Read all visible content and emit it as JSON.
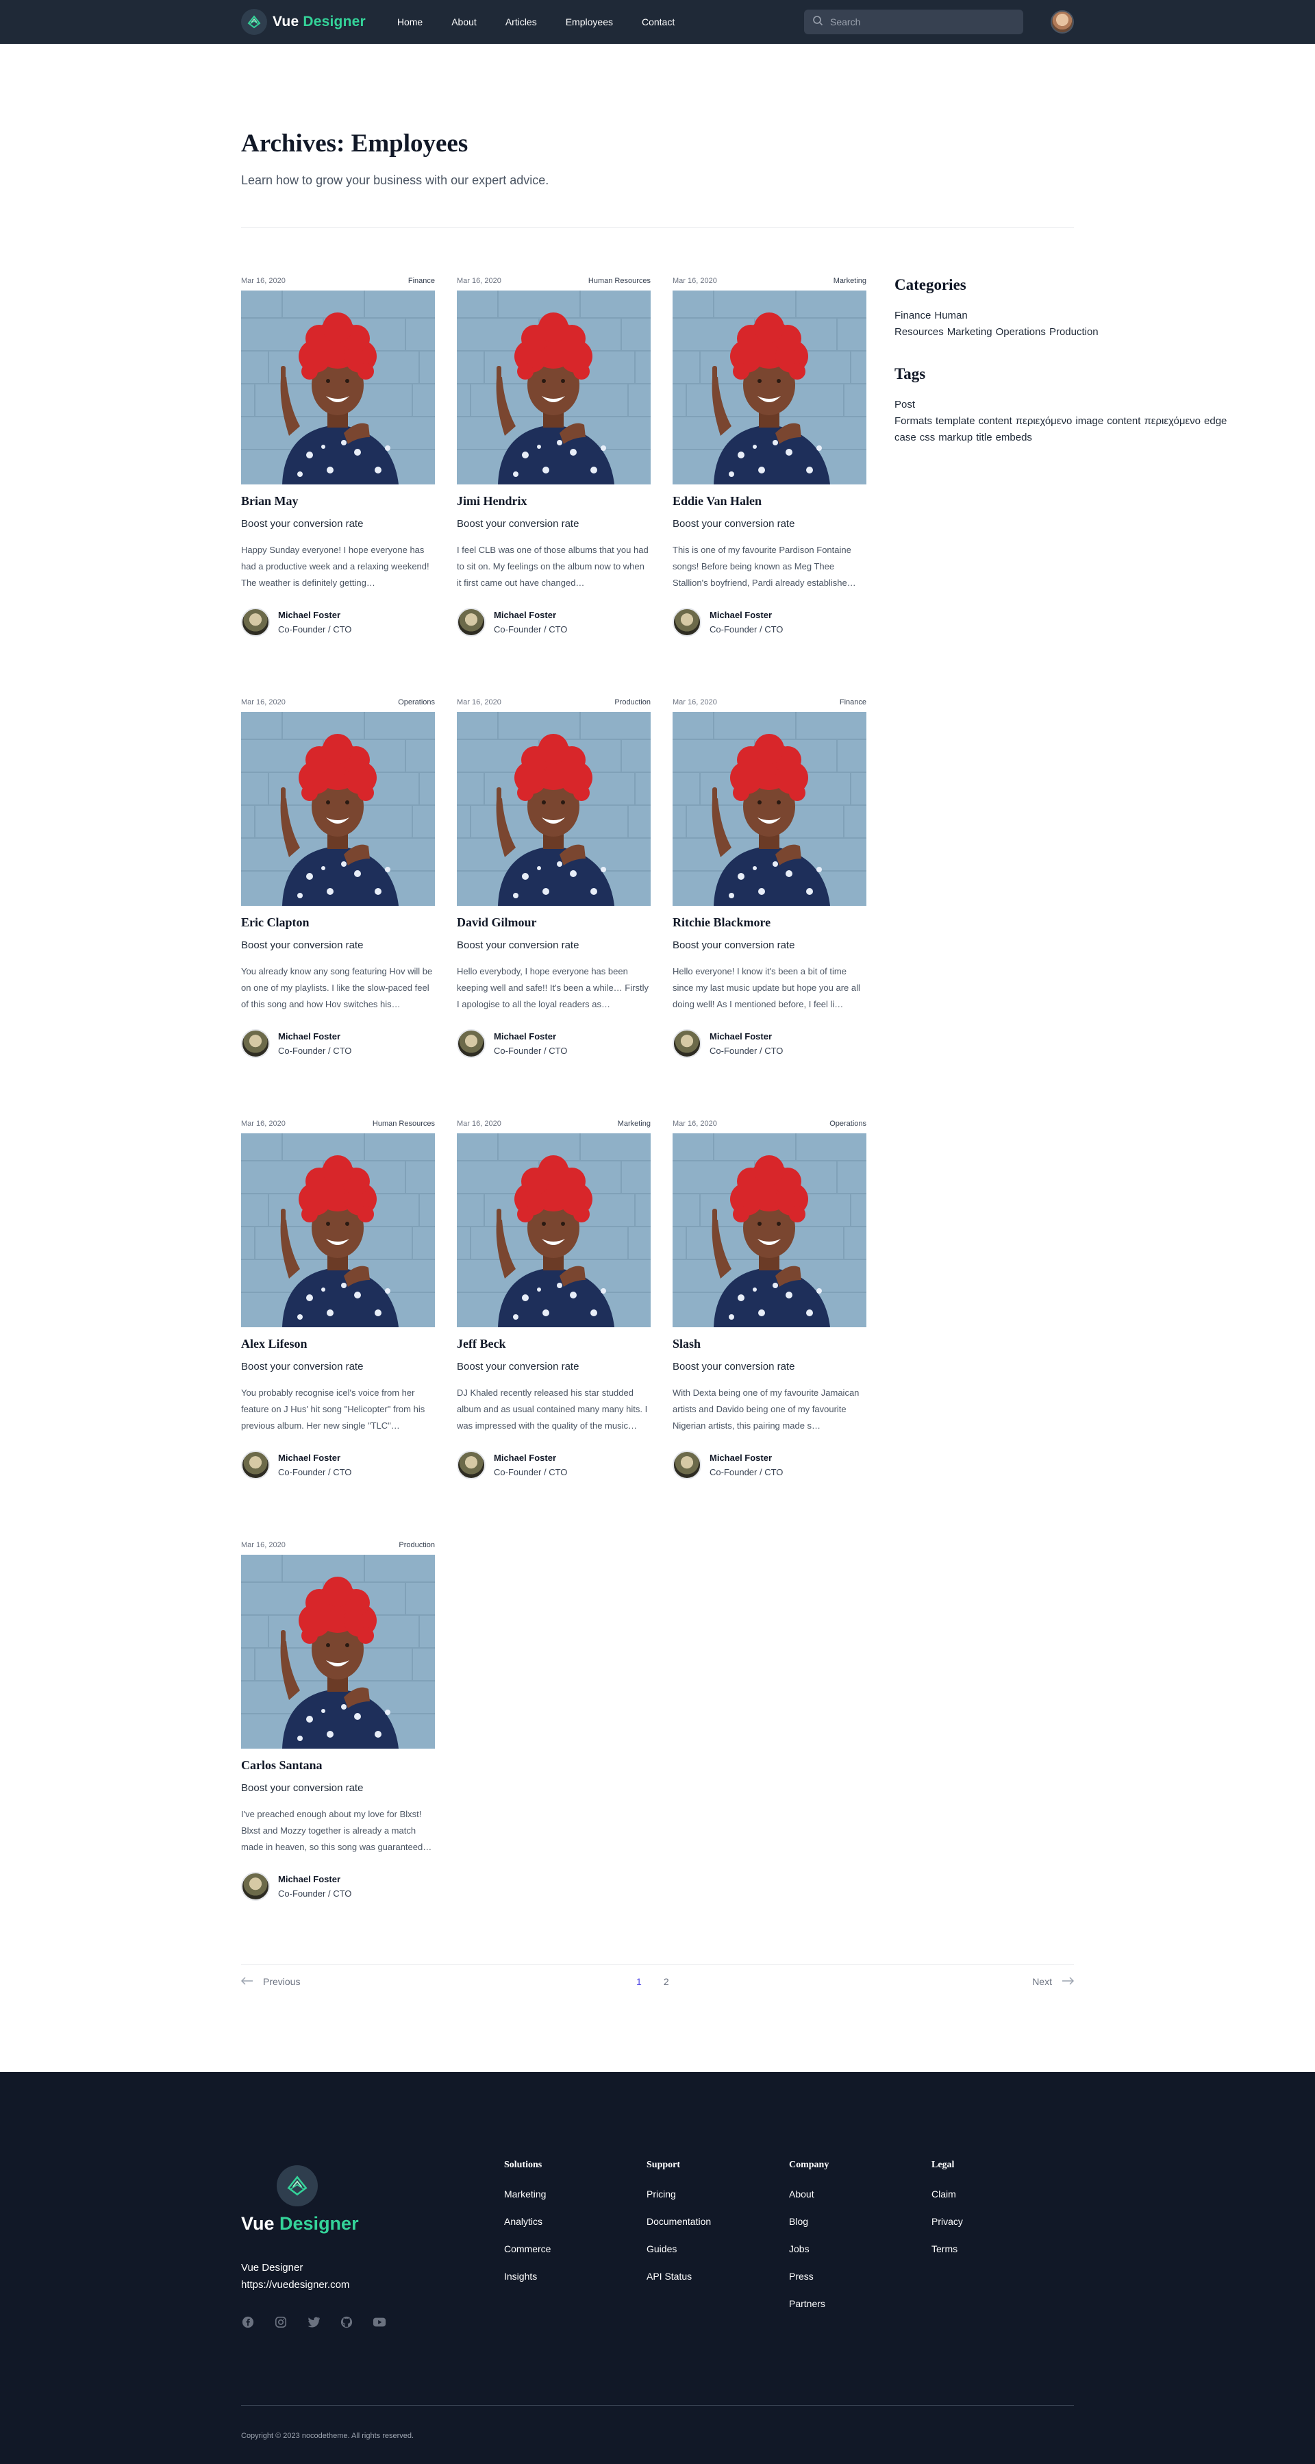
{
  "nav": {
    "brand_word1": "Vue",
    "brand_word2": "Designer",
    "links": [
      "Home",
      "About",
      "Articles",
      "Employees",
      "Contact"
    ],
    "search_placeholder": "Search"
  },
  "header": {
    "title": "Archives: Employees",
    "subtitle": "Learn how to grow your business with our expert advice."
  },
  "posts": [
    {
      "date": "Mar 16, 2020",
      "category": "Finance",
      "name": "Brian May",
      "subtitle": "Boost your conversion rate",
      "excerpt": "Happy Sunday everyone! I hope everyone has had a productive week and a relaxing weekend! The weather is definitely getting…",
      "author": "Michael Foster",
      "role": "Co-Founder / CTO"
    },
    {
      "date": "Mar 16, 2020",
      "category": "Human Resources",
      "name": "Jimi Hendrix",
      "subtitle": "Boost your conversion rate",
      "excerpt": "I feel CLB was one of those albums that you had to sit on. My feelings on the album now to when it first came out have changed…",
      "author": "Michael Foster",
      "role": "Co-Founder / CTO"
    },
    {
      "date": "Mar 16, 2020",
      "category": "Marketing",
      "name": "Eddie Van Halen",
      "subtitle": "Boost your conversion rate",
      "excerpt": "This is one of my favourite Pardison Fontaine songs! Before being known as Meg Thee Stallion's boyfriend, Pardi already establishe…",
      "author": "Michael Foster",
      "role": "Co-Founder / CTO"
    },
    {
      "date": "Mar 16, 2020",
      "category": "Operations",
      "name": "Eric Clapton",
      "subtitle": "Boost your conversion rate",
      "excerpt": "You already know any song featuring Hov will be on one of my playlists. I like the slow-paced feel of this song and how Hov switches his…",
      "author": "Michael Foster",
      "role": "Co-Founder / CTO"
    },
    {
      "date": "Mar 16, 2020",
      "category": "Production",
      "name": "David Gilmour",
      "subtitle": "Boost your conversion rate",
      "excerpt": "Hello everybody, I hope everyone has been keeping well and safe!! It's been a while… Firstly I apologise to all the loyal readers as…",
      "author": "Michael Foster",
      "role": "Co-Founder / CTO"
    },
    {
      "date": "Mar 16, 2020",
      "category": "Finance",
      "name": "Ritchie Blackmore",
      "subtitle": "Boost your conversion rate",
      "excerpt": "Hello everyone! I know it's been a bit of time since my last music update but hope you are all doing well! As I mentioned before, I feel li…",
      "author": "Michael Foster",
      "role": "Co-Founder / CTO"
    },
    {
      "date": "Mar 16, 2020",
      "category": "Human Resources",
      "name": "Alex Lifeson",
      "subtitle": "Boost your conversion rate",
      "excerpt": "You probably recognise icel's voice from her feature on J Hus' hit song \"Helicopter\" from his previous album. Her new single \"TLC\"…",
      "author": "Michael Foster",
      "role": "Co-Founder / CTO"
    },
    {
      "date": "Mar 16, 2020",
      "category": "Marketing",
      "name": "Jeff Beck",
      "subtitle": "Boost your conversion rate",
      "excerpt": "DJ Khaled recently released his star studded album and as usual contained many many hits. I was impressed with the quality of the music…",
      "author": "Michael Foster",
      "role": "Co-Founder / CTO"
    },
    {
      "date": "Mar 16, 2020",
      "category": "Operations",
      "name": "Slash",
      "subtitle": "Boost your conversion rate",
      "excerpt": "With Dexta being one of my favourite Jamaican artists and Davido being one of my favourite Nigerian artists, this pairing made s…",
      "author": "Michael Foster",
      "role": "Co-Founder / CTO"
    },
    {
      "date": "Mar 16, 2020",
      "category": "Production",
      "name": "Carlos Santana",
      "subtitle": "Boost your conversion rate",
      "excerpt": "I've preached enough about my love for Blxst! Blxst and Mozzy together is already a match made in heaven, so this song was guaranteed…",
      "author": "Michael Foster",
      "role": "Co-Founder / CTO"
    }
  ],
  "sidebar": {
    "categories_title": "Categories",
    "categories": [
      "Finance",
      "Human Resources",
      "Marketing",
      "Operations",
      "Production"
    ],
    "tags_title": "Tags",
    "tags": [
      "Post Formats",
      "template",
      "content",
      "περιεχόμενο",
      "image",
      "content",
      "περιεχόμενο",
      "edge case",
      "css",
      "markup",
      "title",
      "embeds"
    ]
  },
  "pagination": {
    "previous": "Previous",
    "pages": [
      "1",
      "2"
    ],
    "next": "Next",
    "active_page": "1"
  },
  "footer": {
    "brand_word1": "Vue",
    "brand_word2": "Designer",
    "company": "Vue Designer",
    "url": "https://vuedesigner.com",
    "socials": [
      "facebook-icon",
      "instagram-icon",
      "twitter-icon",
      "github-icon",
      "youtube-icon"
    ],
    "columns": [
      {
        "title": "Solutions",
        "items": [
          "Marketing",
          "Analytics",
          "Commerce",
          "Insights"
        ]
      },
      {
        "title": "Support",
        "items": [
          "Pricing",
          "Documentation",
          "Guides",
          "API Status"
        ]
      },
      {
        "title": "Company",
        "items": [
          "About",
          "Blog",
          "Jobs",
          "Press",
          "Partners"
        ]
      },
      {
        "title": "Legal",
        "items": [
          "Claim",
          "Privacy",
          "Terms"
        ]
      }
    ],
    "copyright": "Copyright ©  2023  nocodetheme. All rights reserved."
  },
  "colors": {
    "nav_bg": "#1f2937",
    "footer_bg": "#111827",
    "accent_green": "#34d399",
    "active_page": "#4f46e5",
    "photo_wall": "#8fb0c7",
    "hair": "#d8262a"
  }
}
